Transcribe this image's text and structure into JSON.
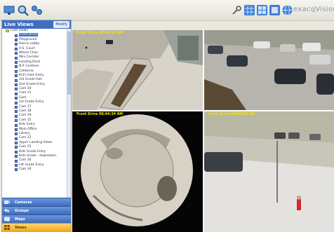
{
  "toolbar": {
    "left_icons": [
      "monitor-icon",
      "magnifier-icon",
      "camera-link-icon"
    ],
    "right_icons": [
      "key-icon",
      "layout-grid-icon",
      "multi-view-icon",
      "single-view-icon",
      "globe-icon"
    ],
    "logo_text": "exacqVision"
  },
  "sidebar": {
    "title": "Live Views",
    "modify_label": "Modify",
    "root_label": "Cam Views",
    "items": [
      {
        "label": "Front Drive",
        "selected": true
      },
      {
        "label": "Playground"
      },
      {
        "label": "Dance Lobby"
      },
      {
        "label": "A.S. Court"
      },
      {
        "label": "Wheel Chair"
      },
      {
        "label": "Mini Corridor"
      },
      {
        "label": "Loading Dock"
      },
      {
        "label": "N.P. Canteen"
      },
      {
        "label": "Cafeteria"
      },
      {
        "label": "Kid's Hole Entry"
      },
      {
        "label": "3rd Grade Hall"
      },
      {
        "label": "2nd Grade Entry"
      },
      {
        "label": "Cam 10"
      },
      {
        "label": "Cam 11"
      },
      {
        "label": "Gym"
      },
      {
        "label": "1st Grade Entry"
      },
      {
        "label": "Cam 17"
      },
      {
        "label": "Cam 18"
      },
      {
        "label": "Cam 19"
      },
      {
        "label": "Cam 15"
      },
      {
        "label": "Kids Entry"
      },
      {
        "label": "Main Office"
      },
      {
        "label": "Library"
      },
      {
        "label": "Cam 22"
      },
      {
        "label": "Upper Landing Views"
      },
      {
        "label": "Cam 25"
      },
      {
        "label": "Kids Grade Entry"
      },
      {
        "label": "Kids Grade - downstairs"
      },
      {
        "label": "Cam 30"
      },
      {
        "label": "Lift Grade Entry"
      },
      {
        "label": "Cam 30"
      }
    ],
    "nav": [
      {
        "label": "Cameras",
        "icon": "camera-icon"
      },
      {
        "label": "Groups",
        "icon": "groups-icon"
      },
      {
        "label": "Maps",
        "icon": "map-icon"
      },
      {
        "label": "Views",
        "icon": "views-icon",
        "active": true
      }
    ]
  },
  "video": {
    "tiles": [
      {
        "name": "tile-plaza",
        "timestamp": "Front Drive 08:44:34 AM"
      },
      {
        "name": "tile-parking",
        "timestamp": ""
      },
      {
        "name": "tile-fisheye",
        "timestamp": "Front Drive 08:44:34 AM"
      },
      {
        "name": "tile-street",
        "timestamp": "Front Drive 08:44:34 AM"
      }
    ]
  },
  "colors": {
    "accent_blue": "#3f6fc0",
    "active_nav": "#f0a820",
    "timestamp": "#f2e600"
  }
}
